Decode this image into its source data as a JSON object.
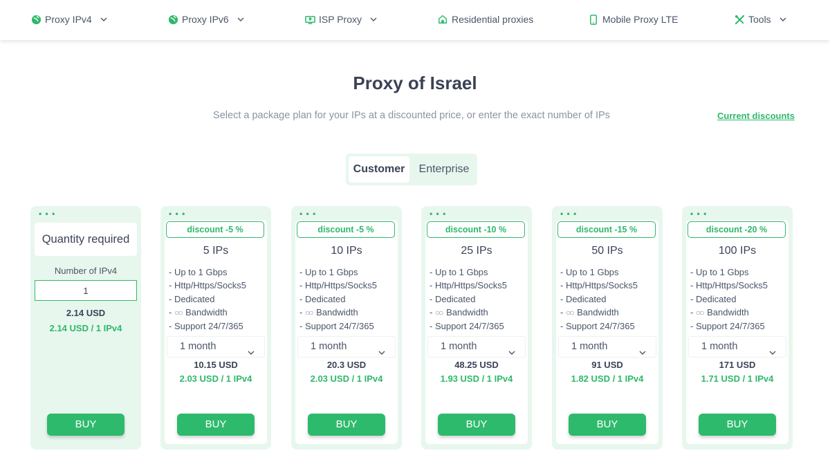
{
  "nav": {
    "items": [
      {
        "label": "Proxy IPv4",
        "icon": "globe-icon",
        "dropdown": true
      },
      {
        "label": "Proxy IPv6",
        "icon": "globe-icon",
        "dropdown": true
      },
      {
        "label": "ISP Proxy",
        "icon": "location-monitor-icon",
        "dropdown": true
      },
      {
        "label": "Residential proxies",
        "icon": "home-icon",
        "dropdown": false
      },
      {
        "label": "Mobile Proxy LTE",
        "icon": "phone-icon",
        "dropdown": false
      },
      {
        "label": "Tools",
        "icon": "tools-icon",
        "dropdown": true
      }
    ]
  },
  "header": {
    "title": "Proxy of Israel",
    "subtitle": "Select a package plan for your IPs at a discounted price, or enter the exact number of IPs",
    "discounts_link": "Current discounts"
  },
  "tabs": {
    "customer": "Customer",
    "enterprise": "Enterprise"
  },
  "custom_card": {
    "title": "Quantity required",
    "label": "Number of IPv4",
    "quantity": "1",
    "total": "2.14 USD",
    "per_ip": "2.14 USD / 1 IPv4",
    "buy": "BUY"
  },
  "features": [
    "- Up to 1 Gbps",
    "- Http/Https/Socks5",
    "- Dedicated",
    "Bandwidth",
    "- Support 24/7/365"
  ],
  "period_default": "1 month",
  "plans": [
    {
      "discount": "discount -5 %",
      "ips": "5 IPs",
      "total": "10.15 USD",
      "per_ip": "2.03 USD / 1 IPv4",
      "buy": "BUY"
    },
    {
      "discount": "discount -5 %",
      "ips": "10 IPs",
      "total": "20.3 USD",
      "per_ip": "2.03 USD / 1 IPv4",
      "buy": "BUY"
    },
    {
      "discount": "discount -10 %",
      "ips": "25 IPs",
      "total": "48.25 USD",
      "per_ip": "1.93 USD / 1 IPv4",
      "buy": "BUY"
    },
    {
      "discount": "discount -15 %",
      "ips": "50 IPs",
      "total": "91 USD",
      "per_ip": "1.82 USD / 1 IPv4",
      "buy": "BUY"
    },
    {
      "discount": "discount -20 %",
      "ips": "100 IPs",
      "total": "171 USD",
      "per_ip": "1.71 USD / 1 IPv4",
      "buy": "BUY"
    }
  ],
  "colors": {
    "accent": "#2eb86a",
    "card_bg": "#e8f7ee",
    "text": "#3b4256"
  }
}
